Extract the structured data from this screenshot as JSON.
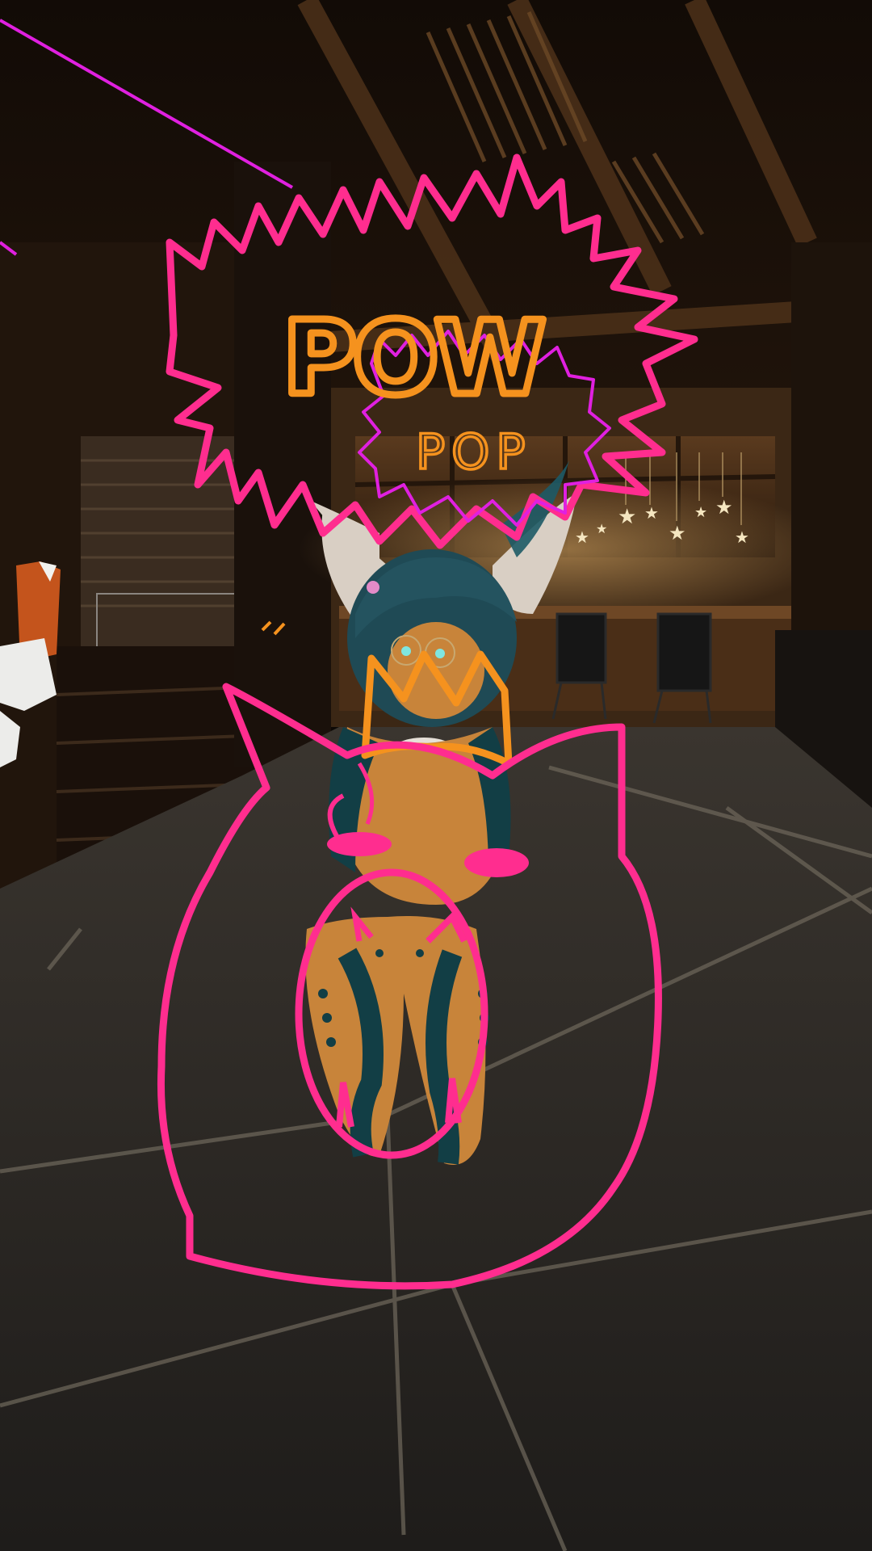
{
  "scene": {
    "type": "vr-world-screenshot",
    "setting": "dark wooden lodge interior with bar counter, hanging star lights and patterned carpet"
  },
  "drawings": {
    "pen_colors": {
      "pink": "#ff2d8f",
      "orange": "#f5921e",
      "magenta": "#e020e0"
    },
    "texts": {
      "pow": "POW",
      "pop": "POP"
    }
  },
  "colors": {
    "wall": "#1a110a",
    "wood": "#3a2414",
    "floor": "#2b2825",
    "floor_lines": "#6b6458",
    "warm_light": "#c99a5c",
    "avatar_fur": "#c8843a",
    "avatar_teal": "#123e45",
    "avatar_hair": "#1f4a55",
    "ear": "#d9cfc4"
  }
}
